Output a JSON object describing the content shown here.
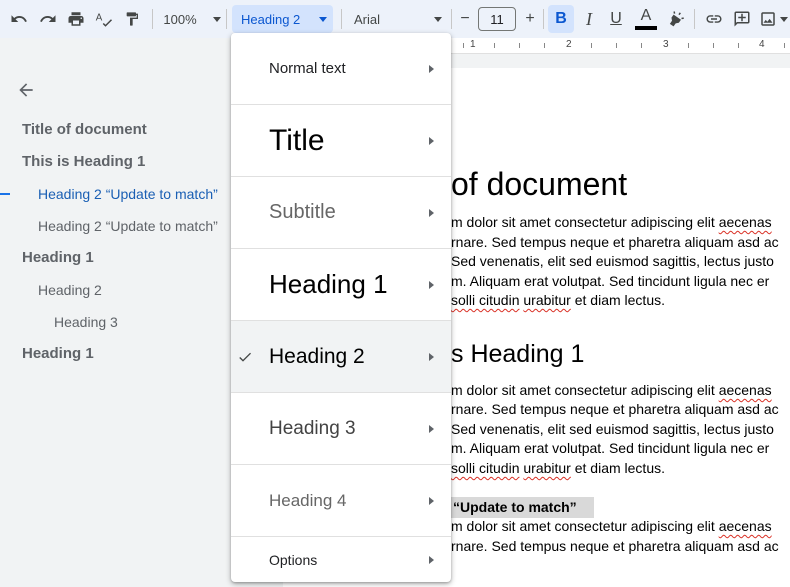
{
  "toolbar": {
    "zoom": "100%",
    "paragraph_style": "Heading 2",
    "font": "Arial",
    "font_size": "11",
    "icons": [
      "undo-icon",
      "redo-icon",
      "print-icon",
      "spellcheck-icon",
      "paint-format-icon",
      "minus-icon",
      "plus-icon",
      "bold-icon",
      "italic-icon",
      "underline-icon",
      "text-color-icon",
      "highlight-icon",
      "link-icon",
      "comment-icon",
      "image-icon"
    ],
    "bold_glyph": "B",
    "italic_glyph": "I",
    "underline_glyph": "U",
    "text_color_glyph": "A",
    "minus_glyph": "−",
    "plus_glyph": "+"
  },
  "ruler": {
    "numbers": [
      "1",
      "2",
      "3",
      "4"
    ]
  },
  "outline": {
    "items": [
      {
        "label": "Title of document",
        "level": "h1"
      },
      {
        "label": "This is Heading 1",
        "level": "h1"
      },
      {
        "label": "Heading 2 “Update to match”",
        "level": "h2",
        "active": true
      },
      {
        "label": "Heading 2 “Update to match”",
        "level": "h2"
      },
      {
        "label": "Heading 1",
        "level": "h1"
      },
      {
        "label": "Heading 2",
        "level": "h2"
      },
      {
        "label": "Heading 3",
        "level": "h3"
      },
      {
        "label": "Heading 1",
        "level": "h1"
      }
    ]
  },
  "style_menu": {
    "items": [
      {
        "label": "Normal text"
      },
      {
        "label": "Title"
      },
      {
        "label": "Subtitle"
      },
      {
        "label": "Heading 1"
      },
      {
        "label": "Heading 2",
        "selected": true
      },
      {
        "label": "Heading 3"
      },
      {
        "label": "Heading 4"
      },
      {
        "label": "Options"
      }
    ]
  },
  "document": {
    "title_fragment": "of document",
    "para1": [
      [
        "m dolor sit amet consectetur adipiscing elit ",
        "aecenas"
      ],
      [
        "rnare. Sed tempus neque et pharetra aliquam asd ac"
      ],
      [
        " Sed venenatis, elit sed euismod sagittis, lectus justo"
      ],
      [
        "m. Aliquam erat volutpat. Sed tincidunt ligula nec er"
      ],
      [
        "solli citudin",
        " ",
        "urabitur",
        " et diam lectus."
      ]
    ],
    "heading1_fragment": "s Heading 1",
    "para2": [
      [
        "m dolor sit amet consectetur adipiscing elit ",
        "aecenas"
      ],
      [
        "rnare. Sed tempus neque et pharetra aliquam asd ac"
      ],
      [
        " Sed venenatis, elit sed euismod sagittis, lectus justo"
      ],
      [
        "m. Aliquam erat volutpat. Sed tincidunt ligula nec er"
      ],
      [
        "solli citudin",
        " ",
        "urabitur",
        " et diam lectus."
      ]
    ],
    "heading2_fragment": " “Update to match”",
    "para3": [
      [
        "m dolor sit amet consectetur adipiscing elit ",
        "aecenas"
      ],
      [
        "rnare. Sed tempus neque et pharetra aliquam asd ac"
      ]
    ]
  }
}
